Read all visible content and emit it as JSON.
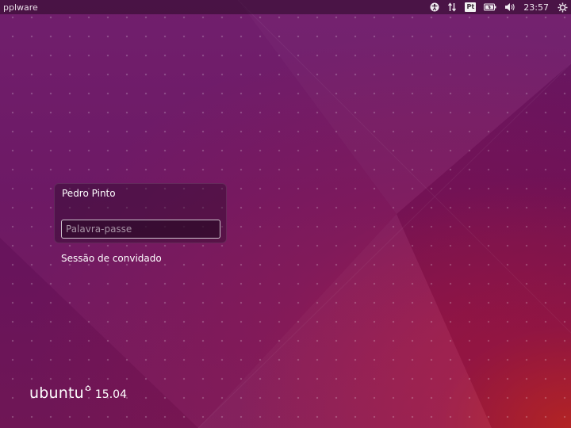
{
  "panel": {
    "hostname": "pplware",
    "indicators": [
      {
        "name": "accessibility-icon"
      },
      {
        "name": "network-icon"
      },
      {
        "name": "keyboard-layout",
        "label": "Pt"
      },
      {
        "name": "battery-icon"
      },
      {
        "name": "volume-icon"
      },
      {
        "name": "power-icon"
      }
    ],
    "keyboard_layout": "Pt",
    "clock": "23:57"
  },
  "login": {
    "user_name": "Pedro Pinto",
    "password_placeholder": "Palavra-passe",
    "password_value": "",
    "guest_session": "Sessão de convidado"
  },
  "branding": {
    "name": "ubuntu",
    "version": "15.04"
  },
  "colors": {
    "panel_bg": "#280a24",
    "wallpaper_purple": "#6a1462",
    "wallpaper_red": "#c8281e",
    "text": "#ffffff"
  }
}
